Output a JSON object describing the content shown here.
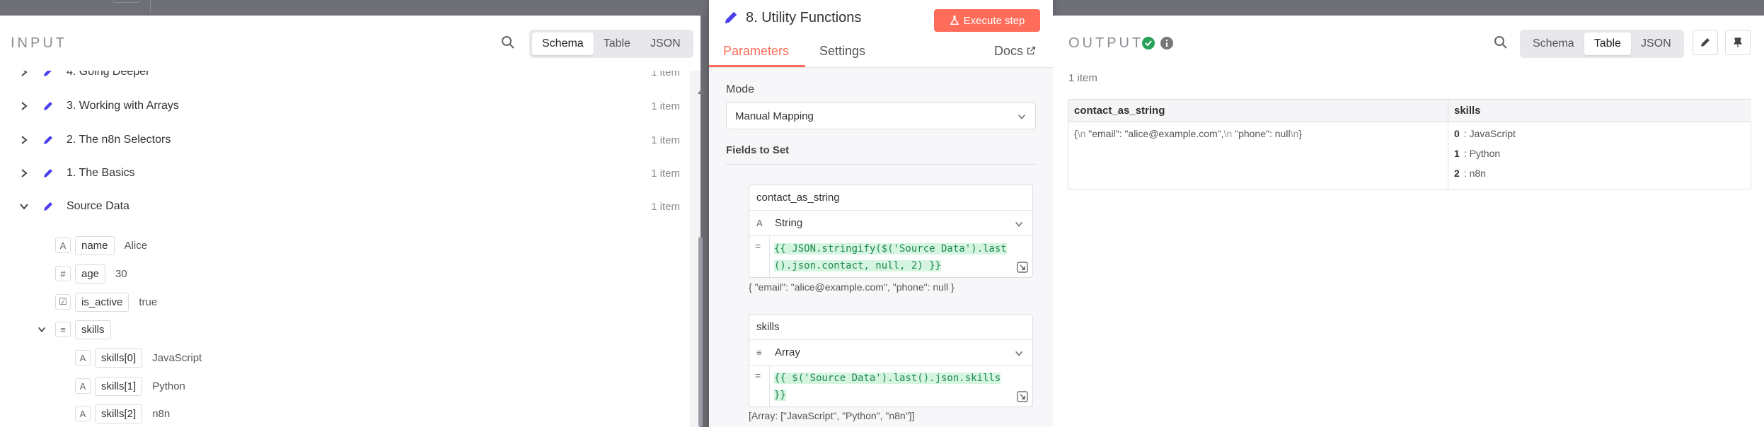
{
  "input": {
    "title": "INPUT",
    "view_options": [
      "Schema",
      "Table",
      "JSON"
    ],
    "active_view": "Schema",
    "nodes": [
      {
        "label": "4. Going Deeper",
        "count": "1 item"
      },
      {
        "label": "3. Working with Arrays",
        "count": "1 item"
      },
      {
        "label": "2. The n8n Selectors",
        "count": "1 item"
      },
      {
        "label": "1. The Basics",
        "count": "1 item"
      },
      {
        "label": "Source Data",
        "count": "1 item"
      }
    ],
    "fields": [
      {
        "type": "A",
        "name": "name",
        "value": "Alice"
      },
      {
        "type": "#",
        "name": "age",
        "value": "30"
      },
      {
        "type": "☑",
        "name": "is_active",
        "value": "true"
      },
      {
        "type": "≡",
        "name": "skills",
        "value": ""
      },
      {
        "type": "A",
        "name": "skills[0]",
        "value": "JavaScript"
      },
      {
        "type": "A",
        "name": "skills[1]",
        "value": "Python"
      },
      {
        "type": "A",
        "name": "skills[2]",
        "value": "n8n"
      }
    ]
  },
  "node": {
    "title": "8. Utility Functions",
    "execute_label": "Execute step",
    "tabs": [
      "Parameters",
      "Settings"
    ],
    "docs_label": "Docs",
    "mode_label": "Mode",
    "mode_value": "Manual Mapping",
    "fields_to_set_label": "Fields to Set",
    "assignments": [
      {
        "name": "contact_as_string",
        "type": "String",
        "type_icon": "A",
        "expr_line1": "{{ JSON.stringify($('Source Data').last",
        "expr_line2": "().json.contact, null, 2) }}",
        "preview": "{   \"email\": \"alice@example.com\",   \"phone\": null }"
      },
      {
        "name": "skills",
        "type": "Array",
        "type_icon": "≡",
        "expr_line1": "{{ $('Source Data').last().json.skills ",
        "expr_line2": "}}",
        "preview": "[Array: [\"JavaScript\", \"Python\", \"n8n\"]]"
      }
    ]
  },
  "output": {
    "title": "OUTPUT",
    "view_options": [
      "Schema",
      "Table",
      "JSON"
    ],
    "active_view": "Table",
    "items_label": "1 item",
    "columns": [
      "contact_as_string",
      "skills"
    ],
    "contact_parts": [
      "{",
      "\\n",
      "  \"email\": \"alice@example.com\",",
      "\\n",
      "  \"phone\": null",
      "\\n",
      "}"
    ],
    "skills": [
      {
        "index": "0",
        "value": ": JavaScript"
      },
      {
        "index": "1",
        "value": ": Python"
      },
      {
        "index": "2",
        "value": ": n8n"
      }
    ]
  },
  "colors": {
    "accent": "#ff6d5a",
    "success": "#29a35a",
    "pen": "#4b3ef0"
  }
}
